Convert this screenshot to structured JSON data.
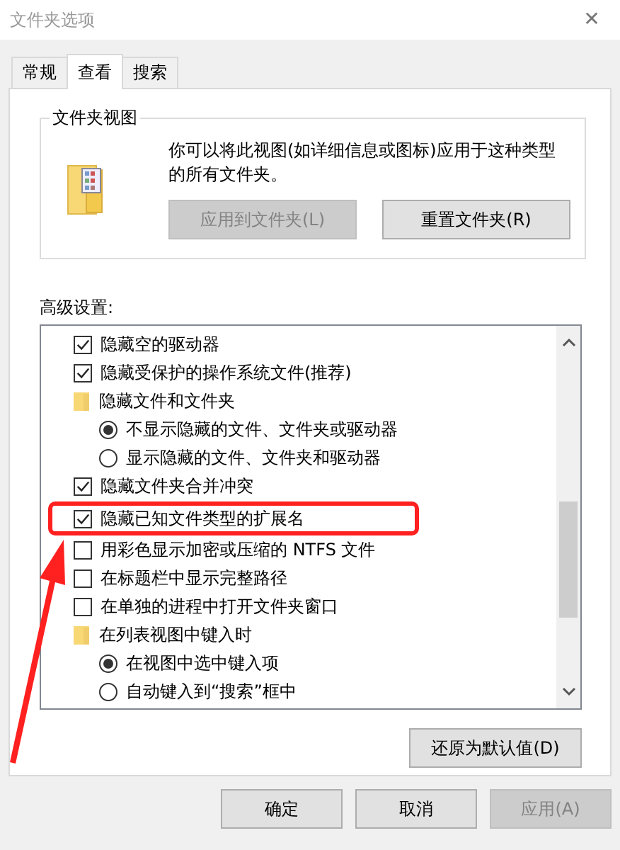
{
  "window": {
    "title": "文件夹选项",
    "close": "✕"
  },
  "tabs": [
    {
      "label": "常规",
      "selected": false
    },
    {
      "label": "查看",
      "selected": true
    },
    {
      "label": "搜索",
      "selected": false
    }
  ],
  "folder_views": {
    "title": "文件夹视图",
    "description": "你可以将此视图(如详细信息或图标)应用于这种类型的所有文件夹。",
    "buttons": [
      {
        "label": "应用到文件夹(L)",
        "disabled": true
      },
      {
        "label": "重置文件夹(R)",
        "disabled": false
      }
    ]
  },
  "advanced": {
    "title": "高级设置:",
    "items": [
      {
        "kind": "checkbox",
        "label": "隐藏空的驱动器",
        "checked": true
      },
      {
        "kind": "checkbox",
        "label": "隐藏受保护的操作系统文件(推荐)",
        "checked": true
      },
      {
        "kind": "group",
        "label": "隐藏文件和文件夹",
        "children": [
          {
            "kind": "radio",
            "label": "不显示隐藏的文件、文件夹或驱动器",
            "selected": true
          },
          {
            "kind": "radio",
            "label": "显示隐藏的文件、文件夹和驱动器",
            "selected": false
          }
        ]
      },
      {
        "kind": "checkbox",
        "label": "隐藏文件夹合并冲突",
        "checked": true
      },
      {
        "kind": "checkbox",
        "label": "隐藏已知文件类型的扩展名",
        "checked": true,
        "highlighted": true
      },
      {
        "kind": "checkbox",
        "label": "用彩色显示加密或压缩的 NTFS 文件",
        "checked": false
      },
      {
        "kind": "checkbox",
        "label": "在标题栏中显示完整路径",
        "checked": false
      },
      {
        "kind": "checkbox",
        "label": "在单独的进程中打开文件夹窗口",
        "checked": false
      },
      {
        "kind": "group",
        "label": "在列表视图中键入时",
        "children": [
          {
            "kind": "radio",
            "label": "在视图中选中键入项",
            "selected": true
          },
          {
            "kind": "radio",
            "label": "自动键入到“搜索”框中",
            "selected": false
          }
        ]
      }
    ],
    "restore_button": "还原为默认值(D)"
  },
  "buttons": [
    {
      "label": "确定",
      "disabled": false
    },
    {
      "label": "取消",
      "disabled": false
    },
    {
      "label": "应用(A)",
      "disabled": true
    }
  ]
}
